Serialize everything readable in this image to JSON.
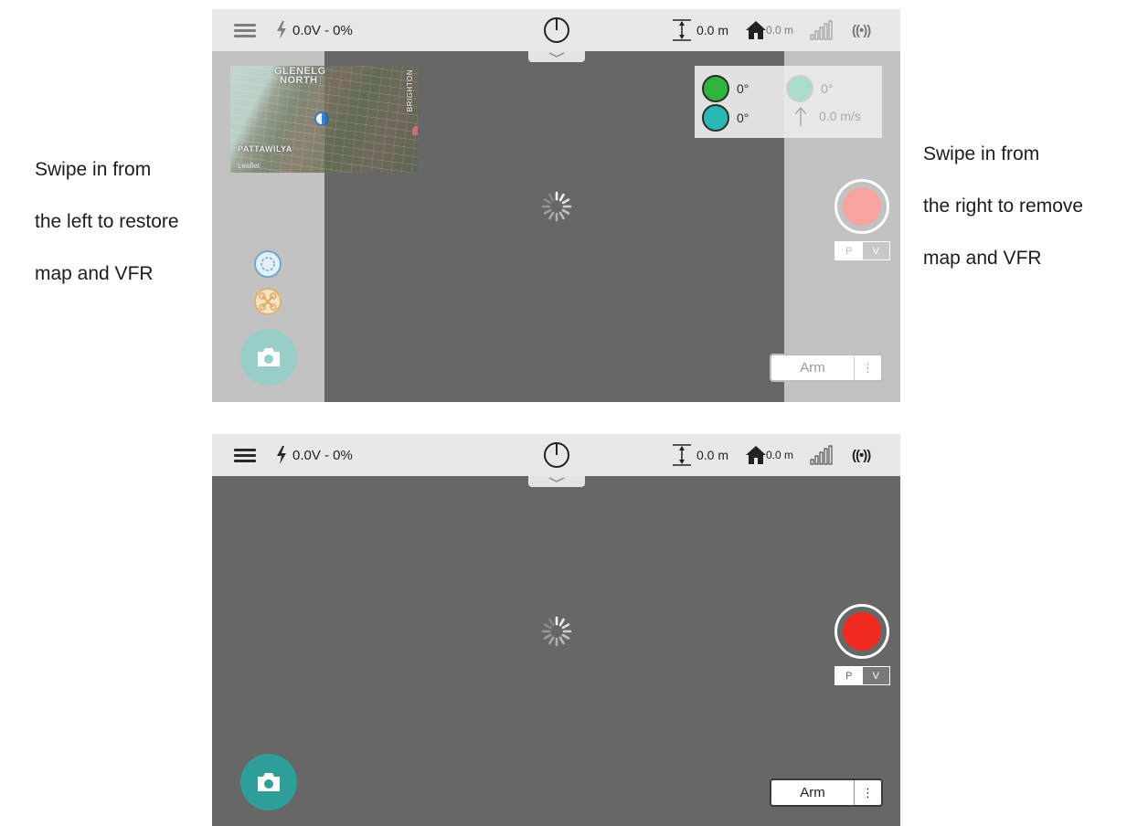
{
  "captions": {
    "left": [
      "Swipe in from",
      "the left to restore",
      "map and VFR"
    ],
    "right": [
      "Swipe in from",
      "the right to remove",
      "map and VFR"
    ]
  },
  "status_bar": {
    "battery": "0.0V - 0%",
    "altitude": "0.0 m",
    "home_distance": "0.0 m"
  },
  "map": {
    "labels": [
      "GLENELG",
      "NORTH",
      "PATTAWILYA"
    ],
    "side_label": "BRIGHTON",
    "attribution": "Leaflet"
  },
  "vfr": {
    "yaw": "0°",
    "roll": "0°",
    "pitch": "0°",
    "vertical_speed": "0.0 m/s"
  },
  "mode_toggle": {
    "photo": "P",
    "video": "V"
  },
  "arm": {
    "label": "Arm",
    "more": "⋮"
  },
  "colors": {
    "video_background": "#676767",
    "status_bar": "#e8e8e8",
    "camera_button": "#2e9e98",
    "record_button": "#f02a1f",
    "vfr_green": "#2eb43c",
    "vfr_teal": "#27b9b2"
  }
}
